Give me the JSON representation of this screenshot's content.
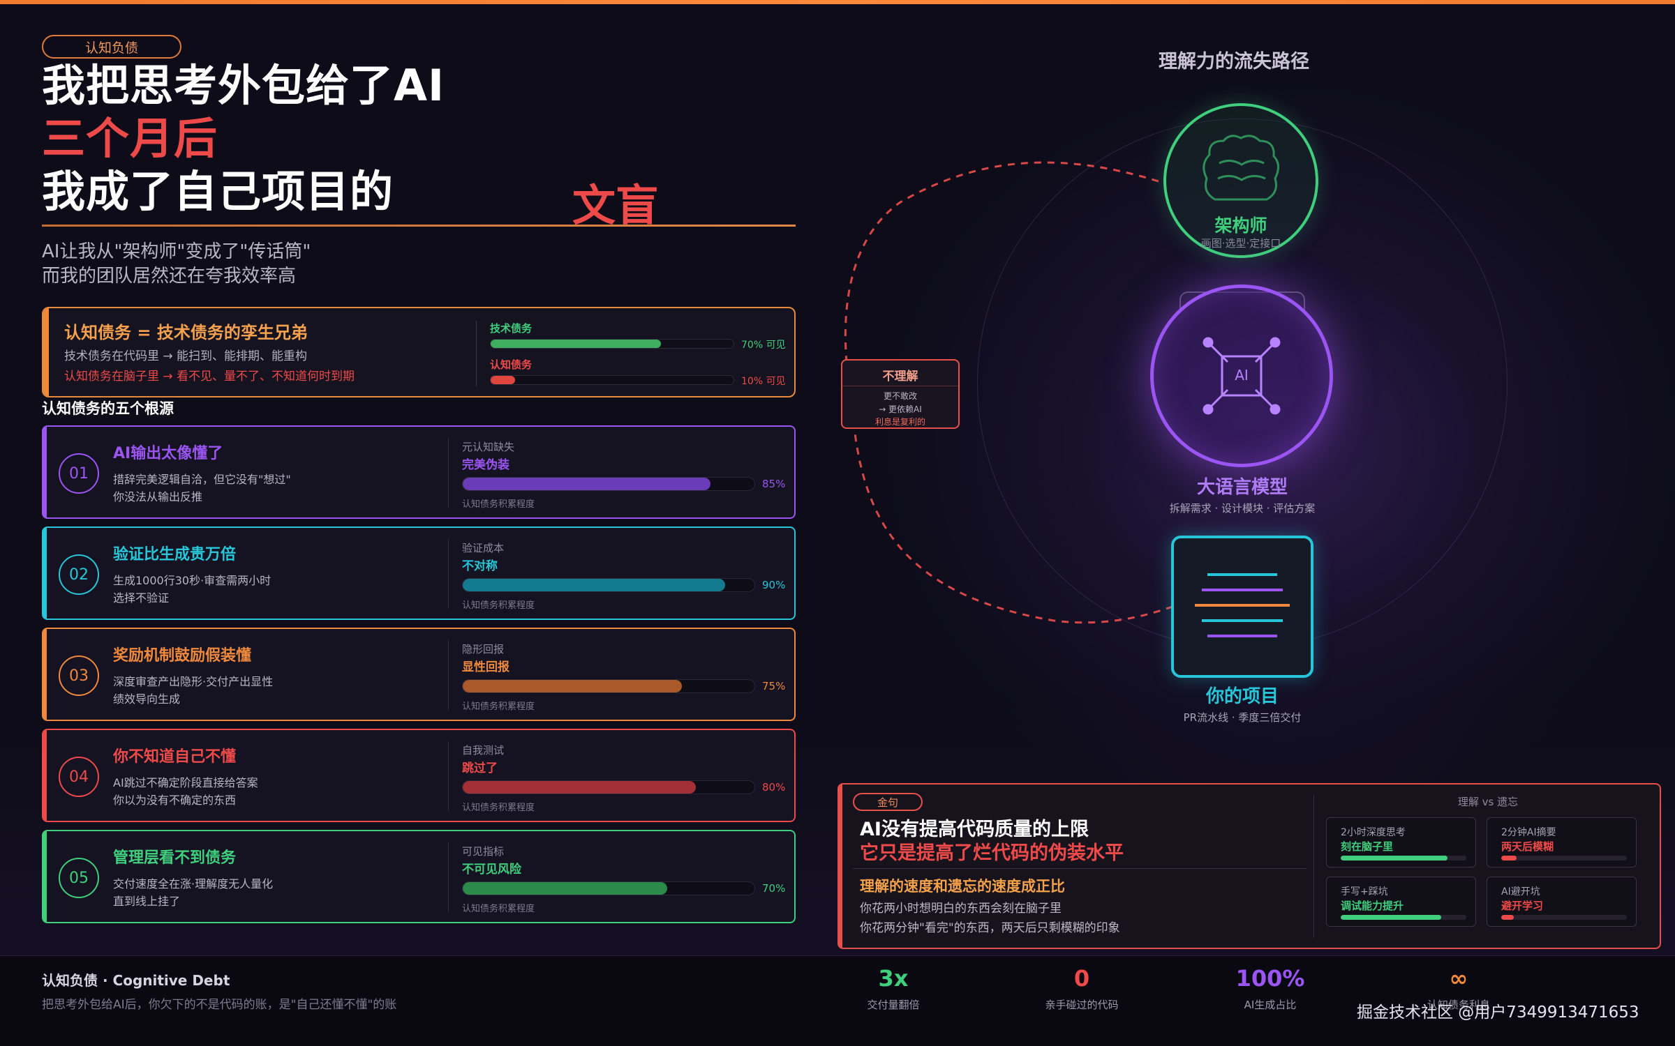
{
  "header": {
    "tag": "认知负债",
    "title_line1": "我把思考外包给了AI",
    "title_line2": "三个月后",
    "title_line3": "我成了自己项目的",
    "title_line3_highlight": "文盲",
    "subtitle_line1": "AI让我从\"架构师\"变成了\"传话筒\"",
    "subtitle_line2": "而我的团队居然还在夸我效率高"
  },
  "debt_compare": {
    "title": "认知债务 = 技术债务的孪生兄弟",
    "desc1": "技术债务在代码里 → 能扫到、能排期、能重构",
    "desc2": "认知债务在脑子里 → 看不见、量不了、不知道何时到期",
    "bars": [
      {
        "label": "技术债务",
        "value": 70,
        "text": "70% 可见",
        "color": "#3fae5f"
      },
      {
        "label": "认知债务",
        "value": 10,
        "text": "10% 可见",
        "color": "#e0463e"
      }
    ]
  },
  "causes_title": "认知债务的五个根源",
  "causes": [
    {
      "num": "01",
      "title": "AI输出太像懂了",
      "d1": "措辞完美逻辑自洽，但它没有\"想过\"",
      "d2": "你没法从输出反推",
      "key": "元认知缺失",
      "value_label": "完美伪装",
      "pct": 85,
      "pct_text": "85%",
      "foot": "认知债务积累程度",
      "color": "#9b55f2",
      "fill": "#6a3cb8"
    },
    {
      "num": "02",
      "title": "验证比生成贵万倍",
      "d1": "生成1000行30秒·审查需两小时",
      "d2": "选择不验证",
      "key": "验证成本",
      "value_label": "不对称",
      "pct": 90,
      "pct_text": "90%",
      "foot": "认知债务积累程度",
      "color": "#27c6d8",
      "fill": "#137a8f"
    },
    {
      "num": "03",
      "title": "奖励机制鼓励假装懂",
      "d1": "深度审查产出隐形·交付产出显性",
      "d2": "绩效导向生成",
      "key": "隐形回报",
      "value_label": "显性回报",
      "pct": 75,
      "pct_text": "75%",
      "foot": "认知债务积累程度",
      "color": "#f0893b",
      "fill": "#a9592a"
    },
    {
      "num": "04",
      "title": "你不知道自己不懂",
      "d1": "AI跳过不确定阶段直接给答案",
      "d2": "你以为没有不确定的东西",
      "key": "自我测试",
      "value_label": "跳过了",
      "pct": 80,
      "pct_text": "80%",
      "foot": "认知债务积累程度",
      "color": "#ef4a4a",
      "fill": "#a33036"
    },
    {
      "num": "05",
      "title": "管理层看不到债务",
      "d1": "交付速度全在涨·理解度无人量化",
      "d2": "直到线上挂了",
      "key": "可见指标",
      "value_label": "不可见风险",
      "pct": 70,
      "pct_text": "70%",
      "foot": "认知债务积累程度",
      "color": "#3fcf7d",
      "fill": "#2c8a4a"
    }
  ],
  "diagram": {
    "title": "理解力的流失路径",
    "architect": {
      "label": "架构师",
      "sub": "画图·选型·定接口"
    },
    "llm": {
      "label": "大语言模型",
      "sub": "拆解需求 · 设计模块 · 评估方案",
      "chip": "AI"
    },
    "project": {
      "label": "你的项目",
      "sub": "PR流水线 · 季度三倍交付"
    },
    "misunderstand": {
      "title": "不理解",
      "l1": "更不敢改",
      "l2": "→ 更依赖AI",
      "l3": "利息是复利的"
    }
  },
  "quote": {
    "pill": "金句",
    "line1": "AI没有提高代码质量的上限",
    "line2": "它只是提高了烂代码的伪装水平",
    "sub_title": "理解的速度和遗忘的速度成正比",
    "sub1": "你花两小时想明白的东西会刻在脑子里",
    "sub2": "你花两分钟\"看完\"的东西，两天后只剩模糊的印象",
    "compare_title": "理解 vs 遗忘",
    "cards": [
      {
        "a": "2小时深度思考",
        "b": "刻在脑子里",
        "color": "#3fcf7d",
        "value": 0.85
      },
      {
        "a": "2分钟AI摘要",
        "b": "两天后模糊",
        "color": "#ef4a4a",
        "value": 0.12
      },
      {
        "a": "手写+踩坑",
        "b": "调试能力提升",
        "color": "#3fcf7d",
        "value": 0.8
      },
      {
        "a": "AI避开坑",
        "b": "避开学习",
        "color": "#ef4a4a",
        "value": 0.1
      }
    ]
  },
  "footer": {
    "title": "认知负债 · Cognitive Debt",
    "sub": "把思考外包给AI后，你欠下的不是代码的账，是\"自己还懂不懂\"的账",
    "stats": [
      {
        "value": "3x",
        "label": "交付量翻倍",
        "color": "#3fcf7d"
      },
      {
        "value": "0",
        "label": "亲手碰过的代码",
        "color": "#ef4a4a"
      },
      {
        "value": "100%",
        "label": "AI生成占比",
        "color": "#9b55f2"
      },
      {
        "value": "∞",
        "label": "认知债务利息",
        "color": "#f0893b"
      }
    ],
    "watermark": "掘金技术社区 @用户7349913471653"
  }
}
